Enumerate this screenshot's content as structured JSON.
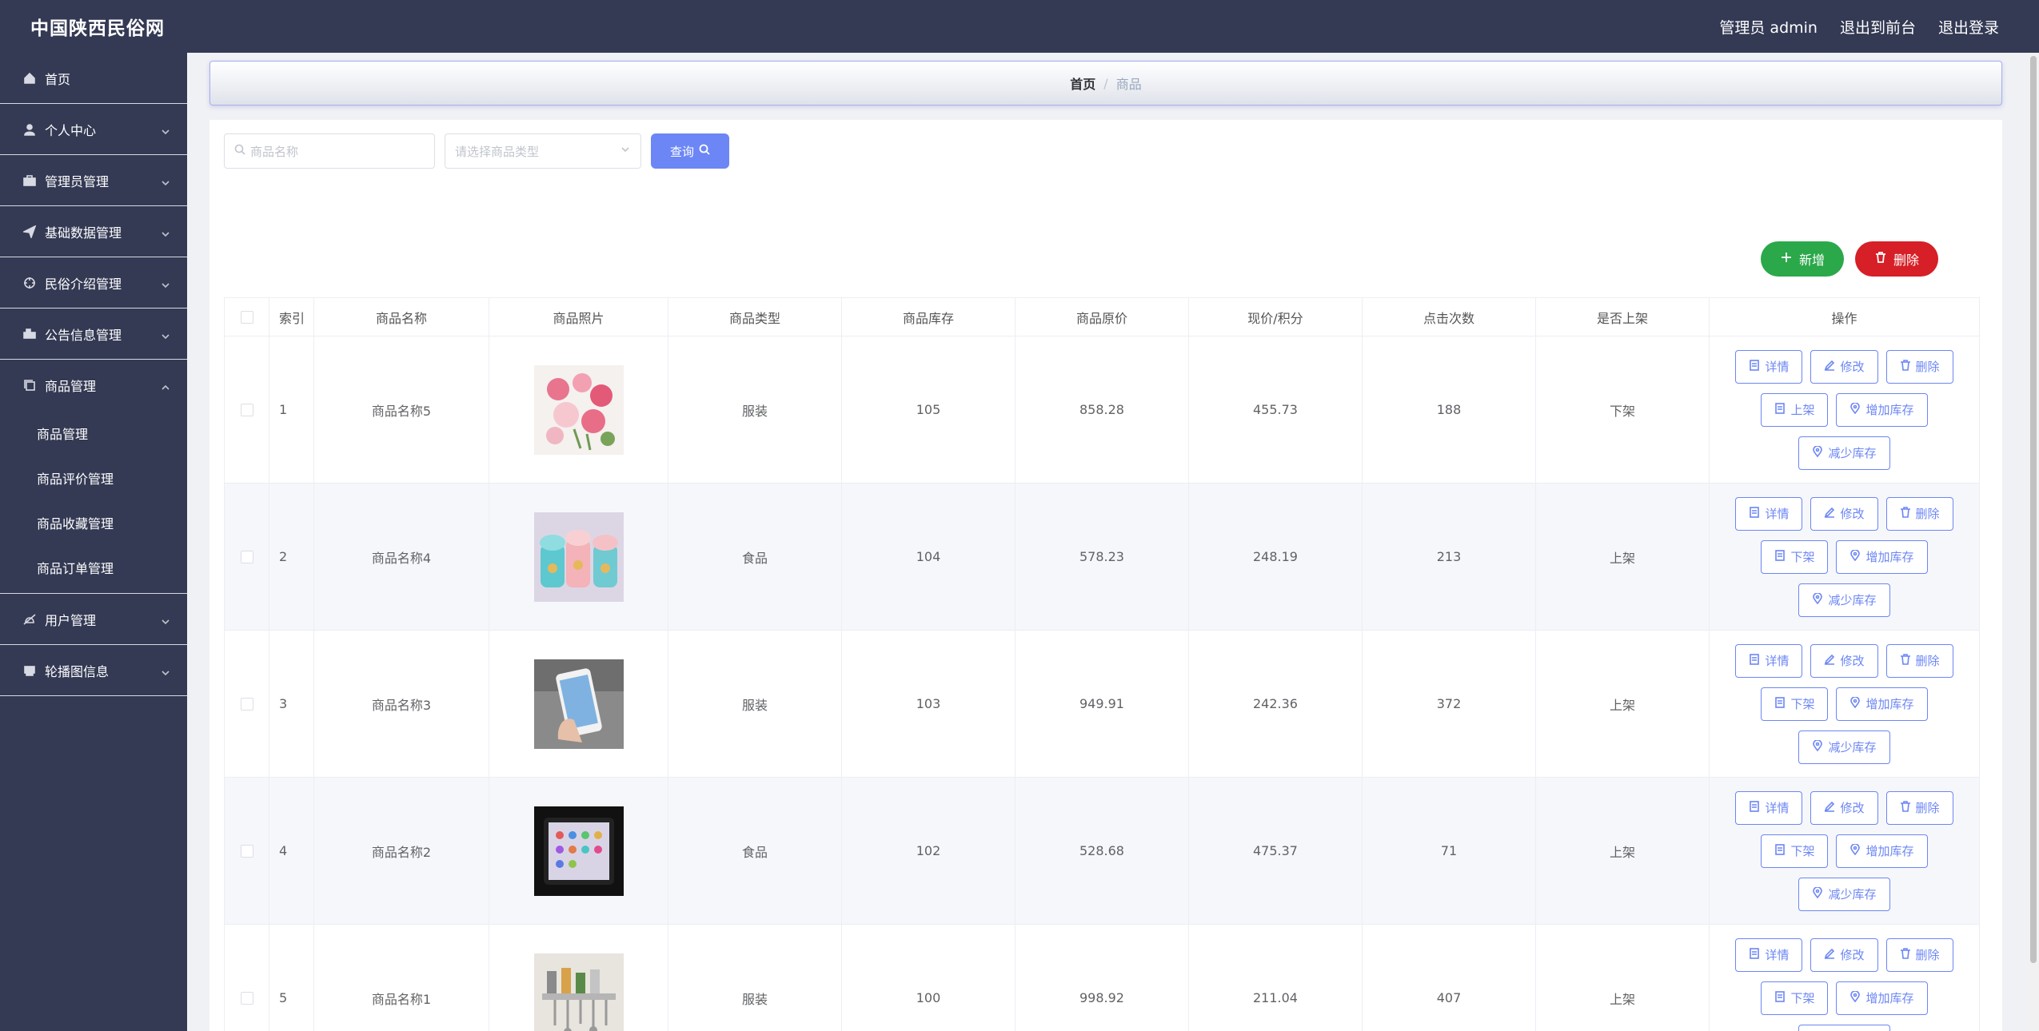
{
  "header": {
    "brand": "中国陕西民俗网",
    "admin_label": "管理员 admin",
    "to_front": "退出到前台",
    "logout": "退出登录"
  },
  "sidebar": {
    "items": [
      {
        "label": "首页",
        "icon": "home-icon"
      },
      {
        "label": "个人中心",
        "icon": "user-icon"
      },
      {
        "label": "管理员管理",
        "icon": "briefcase-icon"
      },
      {
        "label": "基础数据管理",
        "icon": "send-icon"
      },
      {
        "label": "民俗介绍管理",
        "icon": "crosshair-icon"
      },
      {
        "label": "公告信息管理",
        "icon": "bus-icon"
      },
      {
        "label": "商品管理",
        "icon": "copy-icon"
      },
      {
        "label": "用户管理",
        "icon": "bell-icon"
      },
      {
        "label": "轮播图信息",
        "icon": "printer-icon"
      }
    ],
    "submenu": [
      "商品管理",
      "商品评价管理",
      "商品收藏管理",
      "商品订单管理"
    ]
  },
  "breadcrumb": {
    "home": "首页",
    "sep": "/",
    "current": "商品"
  },
  "search": {
    "name_placeholder": "商品名称",
    "type_placeholder": "请选择商品类型",
    "query_label": "查询"
  },
  "actions": {
    "add_label": "新增",
    "delete_label": "删除"
  },
  "table": {
    "headers": [
      "索引",
      "商品名称",
      "商品照片",
      "商品类型",
      "商品库存",
      "商品原价",
      "现价/积分",
      "点击次数",
      "是否上架",
      "操作"
    ],
    "rows": [
      {
        "index": "1",
        "name": "商品名称5",
        "type": "服装",
        "stock": "105",
        "price": "858.28",
        "now": "455.73",
        "clicks": "188",
        "shelf": "下架",
        "toggle": "上架"
      },
      {
        "index": "2",
        "name": "商品名称4",
        "type": "食品",
        "stock": "104",
        "price": "578.23",
        "now": "248.19",
        "clicks": "213",
        "shelf": "上架",
        "toggle": "下架"
      },
      {
        "index": "3",
        "name": "商品名称3",
        "type": "服装",
        "stock": "103",
        "price": "949.91",
        "now": "242.36",
        "clicks": "372",
        "shelf": "上架",
        "toggle": "下架"
      },
      {
        "index": "4",
        "name": "商品名称2",
        "type": "食品",
        "stock": "102",
        "price": "528.68",
        "now": "475.37",
        "clicks": "71",
        "shelf": "上架",
        "toggle": "下架"
      },
      {
        "index": "5",
        "name": "商品名称1",
        "type": "服装",
        "stock": "100",
        "price": "998.92",
        "now": "211.04",
        "clicks": "407",
        "shelf": "上架",
        "toggle": "下架"
      }
    ],
    "ops": {
      "detail": "详情",
      "edit": "修改",
      "delete": "删除",
      "add_stock": "增加库存",
      "reduce_stock": "减少库存"
    }
  },
  "colors": {
    "sidebar": "#343a54",
    "primary": "#6c86f5",
    "success": "#2ba84a",
    "danger": "#d61f26"
  }
}
